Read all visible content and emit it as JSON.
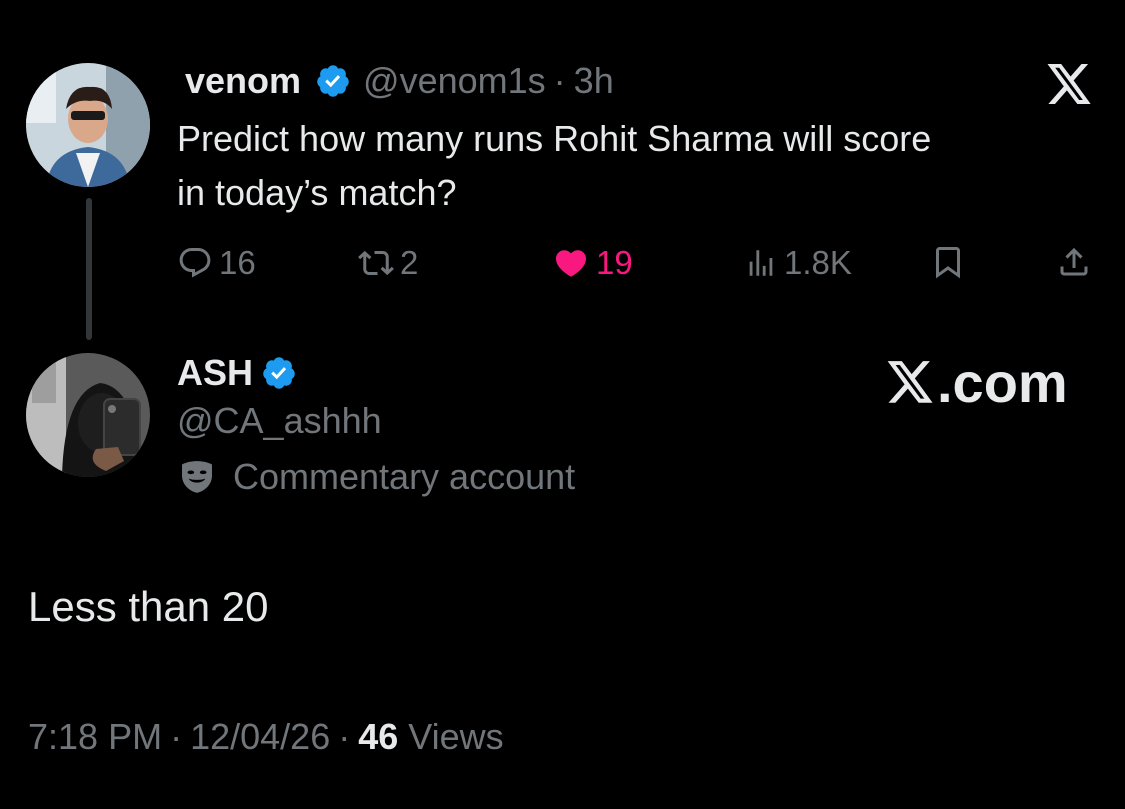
{
  "parent_tweet": {
    "display_name": "venom",
    "handle": "@venom1s",
    "separator": "·",
    "time": "3h",
    "text_line1": "Predict how many runs Rohit Sharma will score",
    "text_line2": "in today’s match?",
    "verified_icon": "verified-badge-icon",
    "actions": {
      "replies": "16",
      "reposts": "2",
      "likes": "19",
      "views": "1.8K"
    }
  },
  "reply_tweet": {
    "display_name": "ASH",
    "handle": "@CA_ashhh",
    "account_label": "Commentary account",
    "account_label_icon": "theater-masks-icon",
    "text": "Less than 20",
    "timestamp_time": "7:18 PM",
    "timestamp_date": "12/04/26",
    "separator": "·",
    "views_count": "46",
    "views_label": "Views"
  },
  "branding": {
    "watermark": "X.com",
    "logo_icon": "x-logo-icon"
  },
  "colors": {
    "background": "#000000",
    "text": "#e7e9ea",
    "muted": "#71767b",
    "verified": "#1d9bf0",
    "like": "#f91880"
  }
}
